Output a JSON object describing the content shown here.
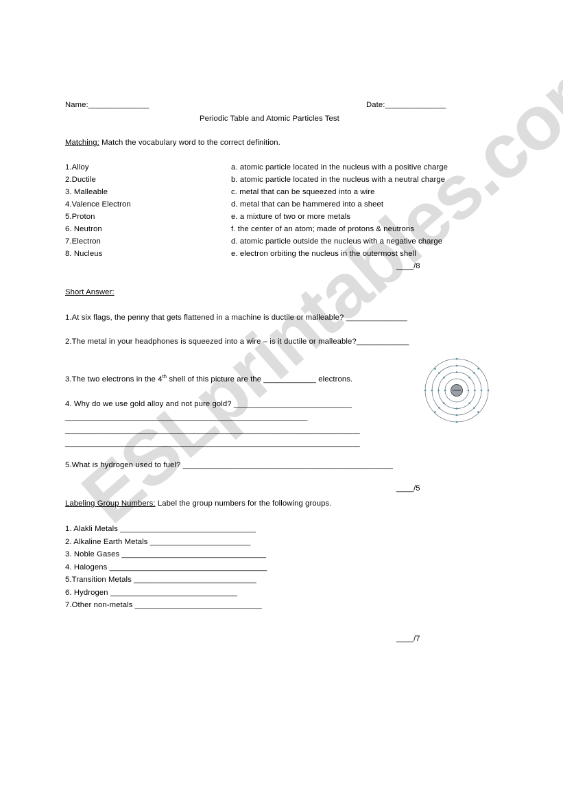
{
  "watermark": {
    "text": "ESLprintables.com"
  },
  "header": {
    "name_label": "Name:",
    "name_blank": "_______________",
    "date_label": "Date:",
    "date_blank": "_______________",
    "title": "Periodic Table and Atomic Particles Test"
  },
  "matching": {
    "section_label": "Matching:",
    "instructions": " Match the vocabulary word to the correct definition.",
    "terms": [
      "1.Alloy",
      "2.Ductile",
      "3. Malleable",
      "4.Valence Electron",
      "5.Proton",
      "6. Neutron",
      "7.Electron",
      "8. Nucleus"
    ],
    "definitions": [
      "a. atomic particle located in the nucleus with a positive charge",
      "b. atomic particle located in the nucleus with a neutral charge",
      "c. metal that can be squeezed into a wire",
      "d. metal that can be hammered into a sheet",
      "e. a mixture of two or more metals",
      "f. the center of an atom; made of protons & neutrons",
      "d. atomic particle outside the nucleus with a negative charge",
      "e. electron orbiting the nucleus in the outermost shell"
    ],
    "score": "____/8"
  },
  "short_answer": {
    "section_label": "Short Answer:",
    "q1": "1.At six flags, the penny that gets flattened in a machine is ductile or malleable? ______________",
    "q2": "2.The metal in your headphones is squeezed into a wire – is it ductile or malleable?____________",
    "q3_before": "3.The two electrons in the 4",
    "q3_sup": "th",
    "q3_after": " shell of this picture are the ____________ electrons.",
    "q4": "4. Why do we use gold alloy and not pure gold? ___________________________",
    "q4_line1": "____________________________________________________________",
    "q4_line2": "_________________________________________________________________________",
    "q4_line3": "_________________________________________________________________________",
    "q5": "5.What is hydrogen used to fuel? ________________________________________________",
    "score": "____/5"
  },
  "labeling": {
    "section_label": "Labeling Group Numbers:",
    "instructions": " Label the group numbers for the following groups.",
    "items": [
      "1.  Alakli Metals _______________________________",
      "2. Alkaline Earth Metals _______________________",
      "3. Noble Gases _________________________________",
      "4. Halogens ____________________________________",
      "5.Transition Metals ____________________________",
      "6. Hydrogen        _____________________________",
      "7.Other non-metals _____________________________"
    ],
    "score": "____/7"
  },
  "atom_diagram": {
    "name": "bohr-model-atom",
    "shells": 4,
    "nucleus_color": "#8f9499",
    "shell_color": "#5b6e78",
    "electron_color": "#4e8fa0"
  }
}
